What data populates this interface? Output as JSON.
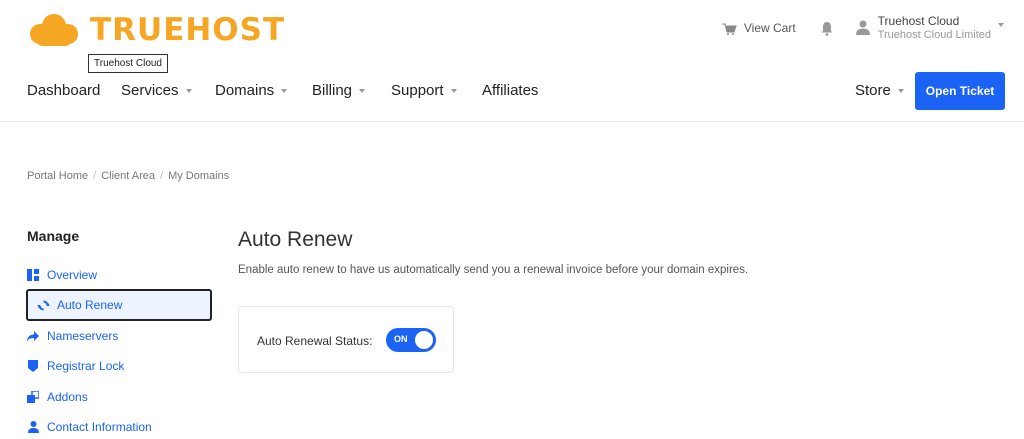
{
  "brand": {
    "name": "TRUEHOST",
    "tooltip": "Truehost Cloud",
    "color": "#f5a623"
  },
  "header": {
    "view_cart": "View Cart",
    "account": {
      "name": "Truehost Cloud",
      "company": "Truehost Cloud Limited"
    }
  },
  "nav": {
    "items": [
      {
        "label": "Dashboard"
      },
      {
        "label": "Services"
      },
      {
        "label": "Domains"
      },
      {
        "label": "Billing"
      },
      {
        "label": "Support"
      },
      {
        "label": "Affiliates"
      }
    ],
    "store": "Store",
    "open_ticket": "Open Ticket"
  },
  "breadcrumb": [
    "Portal Home",
    "Client Area",
    "My Domains"
  ],
  "sidebar": {
    "title": "Manage",
    "items": [
      {
        "label": "Overview",
        "icon": "overview-icon"
      },
      {
        "label": "Auto Renew",
        "icon": "refresh-icon",
        "active": true
      },
      {
        "label": "Nameservers",
        "icon": "share-arrow-icon"
      },
      {
        "label": "Registrar Lock",
        "icon": "lock-shield-icon"
      },
      {
        "label": "Addons",
        "icon": "addons-icon"
      },
      {
        "label": "Contact Information",
        "icon": "user-icon"
      }
    ]
  },
  "main": {
    "title": "Auto Renew",
    "description": "Enable auto renew to have us automatically send you a renewal invoice before your domain expires.",
    "status_label": "Auto Renewal Status:",
    "toggle_text": "ON"
  },
  "colors": {
    "accent": "#1a63f5",
    "brand": "#f5a623"
  }
}
